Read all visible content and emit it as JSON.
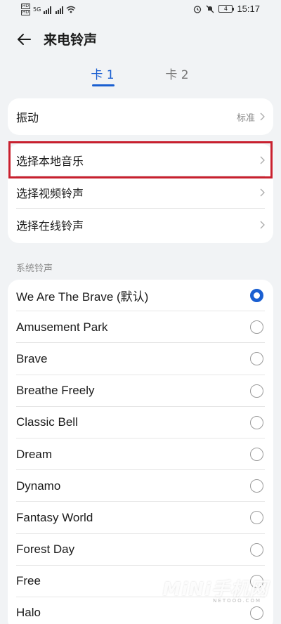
{
  "status_bar": {
    "sim1": "HD",
    "sim1b": "HD",
    "network": "5G",
    "battery": "4",
    "time": "15:17",
    "icons": [
      "alarm-icon",
      "mute-icon",
      "wifi-icon",
      "signal-icon"
    ]
  },
  "header": {
    "title": "来电铃声",
    "back_icon": "arrow-left-icon"
  },
  "tabs": [
    {
      "label": "卡 1",
      "active": true
    },
    {
      "label": "卡 2",
      "active": false
    }
  ],
  "vibration": {
    "label": "振动",
    "value": "标准"
  },
  "options": [
    {
      "label": "选择本地音乐"
    },
    {
      "label": "选择视频铃声"
    },
    {
      "label": "选择在线铃声"
    }
  ],
  "section_label": "系统铃声",
  "ringtones": [
    {
      "label": "We Are The Brave (默认)",
      "selected": true
    },
    {
      "label": "Amusement Park",
      "selected": false
    },
    {
      "label": "Brave",
      "selected": false
    },
    {
      "label": "Breathe Freely",
      "selected": false
    },
    {
      "label": "Classic Bell",
      "selected": false
    },
    {
      "label": "Dream",
      "selected": false
    },
    {
      "label": "Dynamo",
      "selected": false
    },
    {
      "label": "Fantasy World",
      "selected": false
    },
    {
      "label": "Forest Day",
      "selected": false
    },
    {
      "label": "Free",
      "selected": false
    },
    {
      "label": "Halo",
      "selected": false
    }
  ],
  "watermark": "MiNi手机网",
  "watermark_sub": "NETOOO.COM",
  "colors": {
    "accent": "#1a5fd1",
    "highlight_box": "#c8202e",
    "background": "#f1f3f5"
  }
}
